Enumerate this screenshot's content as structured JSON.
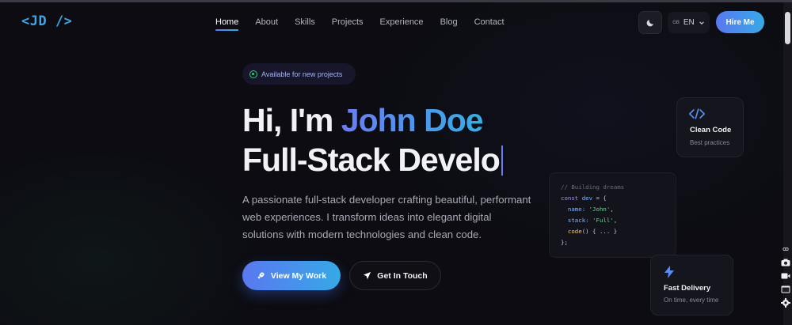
{
  "logo": "<JD />",
  "nav": {
    "items": [
      {
        "label": "Home",
        "active": true
      },
      {
        "label": "About"
      },
      {
        "label": "Skills"
      },
      {
        "label": "Projects"
      },
      {
        "label": "Experience"
      },
      {
        "label": "Blog"
      },
      {
        "label": "Contact"
      }
    ],
    "theme_icon": "moon-icon",
    "language": {
      "flag": "GB",
      "code": "EN",
      "icon": "chevron-down-icon"
    },
    "hire_label": "Hire Me"
  },
  "hero": {
    "badge": "Available for new projects",
    "greeting": "Hi, I'm ",
    "name": "John Doe",
    "typed_role": "Full-Stack Develo",
    "description": "A passionate full-stack developer crafting beautiful, performant web experiences. I transform ideas into elegant digital solutions with modern technologies and clean code.",
    "primary_button": {
      "label": "View My Work",
      "icon": "rocket-icon"
    },
    "secondary_button": {
      "label": "Get In Touch",
      "icon": "send-icon"
    }
  },
  "cards": {
    "clean_code": {
      "title": "Clean Code",
      "subtitle": "Best practices",
      "icon": "code-icon"
    },
    "fast_delivery": {
      "title": "Fast Delivery",
      "subtitle": "On time, every time",
      "icon": "lightning-icon"
    },
    "code_snippet": {
      "comment": "// Building dreams",
      "l1_kw": "const",
      "l1_var": " dev",
      "l1_rest": " = {",
      "l2_prop": "  name:",
      "l2_str": " 'John'",
      "l2_end": ",",
      "l3_prop": "  stack:",
      "l3_str": " 'Full'",
      "l3_end": ",",
      "l4_fn": "  code",
      "l4_rest": "() { ... }",
      "l5": "};"
    }
  },
  "colors": {
    "accent_start": "#5a78f0",
    "accent_end": "#36a9e6",
    "background": "#0c0c12",
    "status_green": "#2fd07a"
  }
}
